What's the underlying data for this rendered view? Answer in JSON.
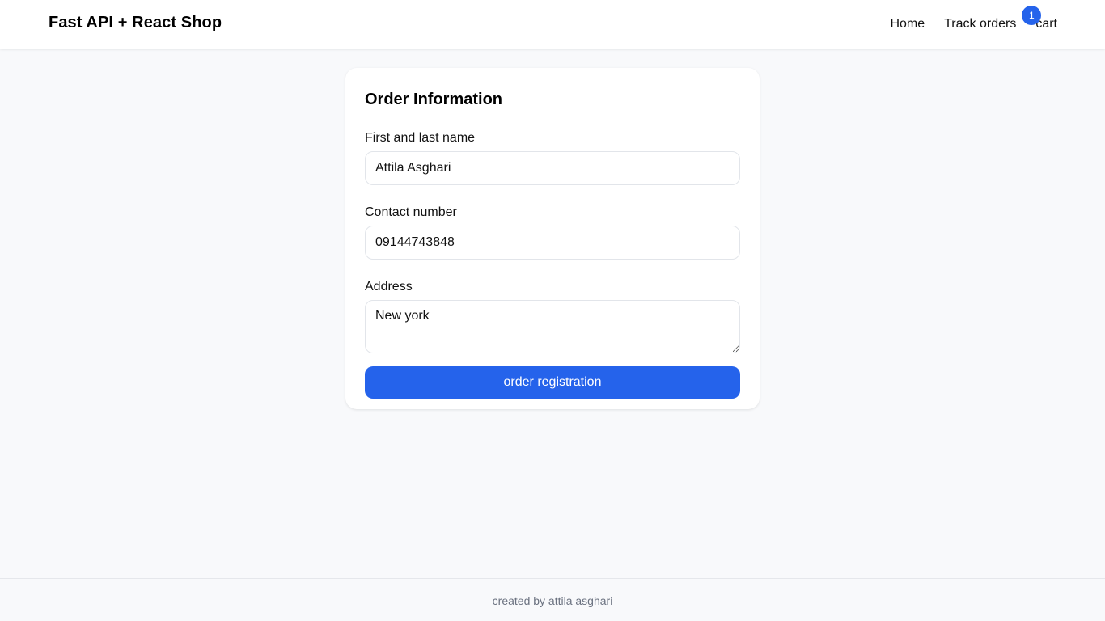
{
  "header": {
    "brand": "Fast API + React Shop",
    "nav": {
      "home": "Home",
      "track_orders": "Track orders",
      "cart": "cart",
      "cart_count": "1"
    }
  },
  "form": {
    "title": "Order Information",
    "name_label": "First and last name",
    "name_value": "Attila Asghari",
    "contact_label": "Contact number",
    "contact_value": "09144743848",
    "address_label": "Address",
    "address_value": "New york",
    "submit_label": "order registration"
  },
  "footer": {
    "text": "created by attila asghari"
  },
  "colors": {
    "accent": "#2563eb",
    "background": "#f8f9fb",
    "card": "#ffffff"
  }
}
